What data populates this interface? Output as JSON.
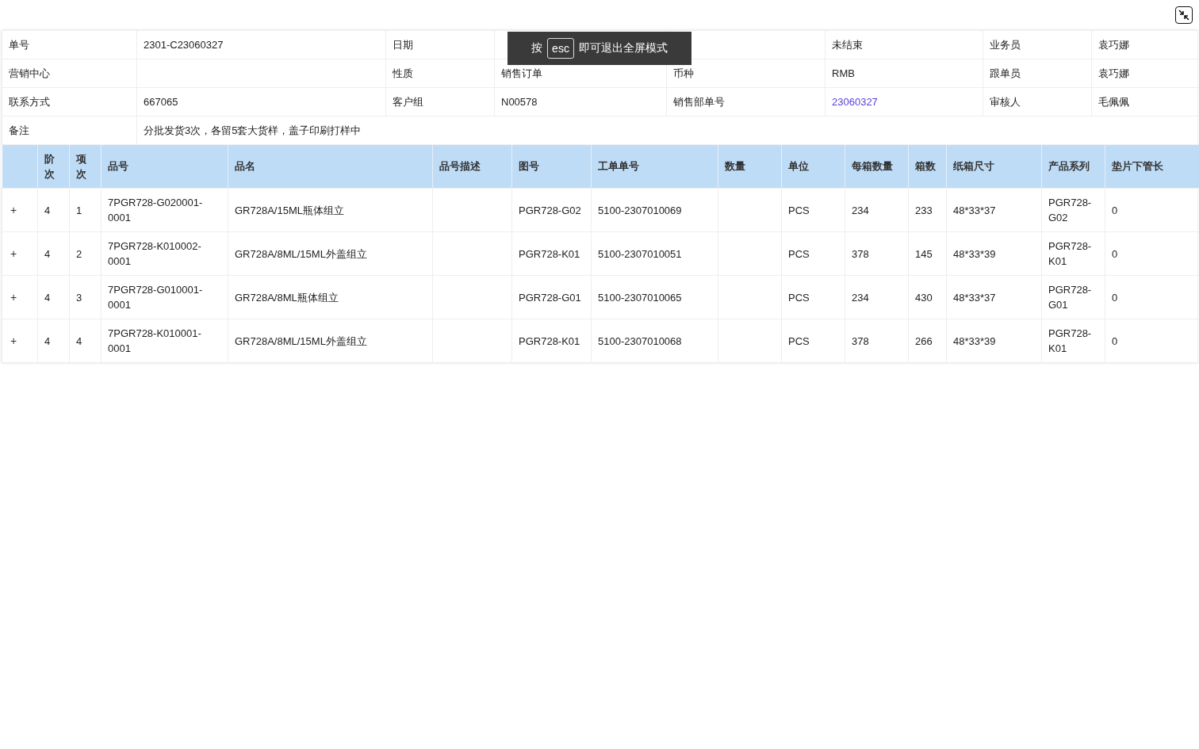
{
  "toast": {
    "prefix": "按",
    "key": "esc",
    "suffix": "即可退出全屏模式"
  },
  "info": {
    "rows": [
      [
        {
          "label": "单号",
          "value": "2301-C23060327"
        },
        {
          "label": "日期"
        },
        {
          "value": "未结束"
        },
        {
          "label": "业务员",
          "value": "袁巧娜"
        }
      ],
      [
        {
          "label": "营销中心"
        },
        {
          "label": "性质",
          "value": "销售订单"
        },
        {
          "label": "币种",
          "value": "RMB"
        },
        {
          "label": "跟单员",
          "value": "袁巧娜"
        }
      ],
      [
        {
          "label": "联系方式",
          "value": "667065"
        },
        {
          "label": "客户组",
          "value": "N00578"
        },
        {
          "label": "销售部单号",
          "value": "23060327",
          "kind": "link"
        },
        {
          "label": "审核人",
          "value": "毛佩佩"
        }
      ]
    ],
    "remark": {
      "label": "备注",
      "value": "分批发货3次，各留5套大货样，盖子印刷打样中"
    }
  },
  "table": {
    "columns": [
      "阶次",
      "项次",
      "品号",
      "品名",
      "品号描述",
      "图号",
      "工单单号",
      "数量",
      "单位",
      "每箱数量",
      "箱数",
      "纸箱尺寸",
      "产品系列",
      "垫片下管长"
    ],
    "rows": [
      {
        "expand": "+",
        "cells": [
          "4",
          "1",
          "7PGR728-G020001-0001",
          "GR728A/15ML瓶体组立",
          "",
          "PGR728-G02",
          "5100-2307010069",
          "",
          "PCS",
          "234",
          "233",
          "48*33*37",
          "PGR728-G02",
          "0"
        ]
      },
      {
        "expand": "+",
        "cells": [
          "4",
          "2",
          "7PGR728-K010002-0001",
          "GR728A/8ML/15ML外盖组立",
          "",
          "PGR728-K01",
          "5100-2307010051",
          "",
          "PCS",
          "378",
          "145",
          "48*33*39",
          "PGR728-K01",
          "0"
        ]
      },
      {
        "expand": "+",
        "cells": [
          "4",
          "3",
          "7PGR728-G010001-0001",
          "GR728A/8ML瓶体组立",
          "",
          "PGR728-G01",
          "5100-2307010065",
          "",
          "PCS",
          "234",
          "430",
          "48*33*37",
          "PGR728-G01",
          "0"
        ]
      },
      {
        "expand": "+",
        "cells": [
          "4",
          "4",
          "7PGR728-K010001-0001",
          "GR728A/8ML/15ML外盖组立",
          "",
          "PGR728-K01",
          "5100-2307010068",
          "",
          "PCS",
          "378",
          "266",
          "48*33*39",
          "PGR728-K01",
          "0"
        ]
      }
    ]
  }
}
